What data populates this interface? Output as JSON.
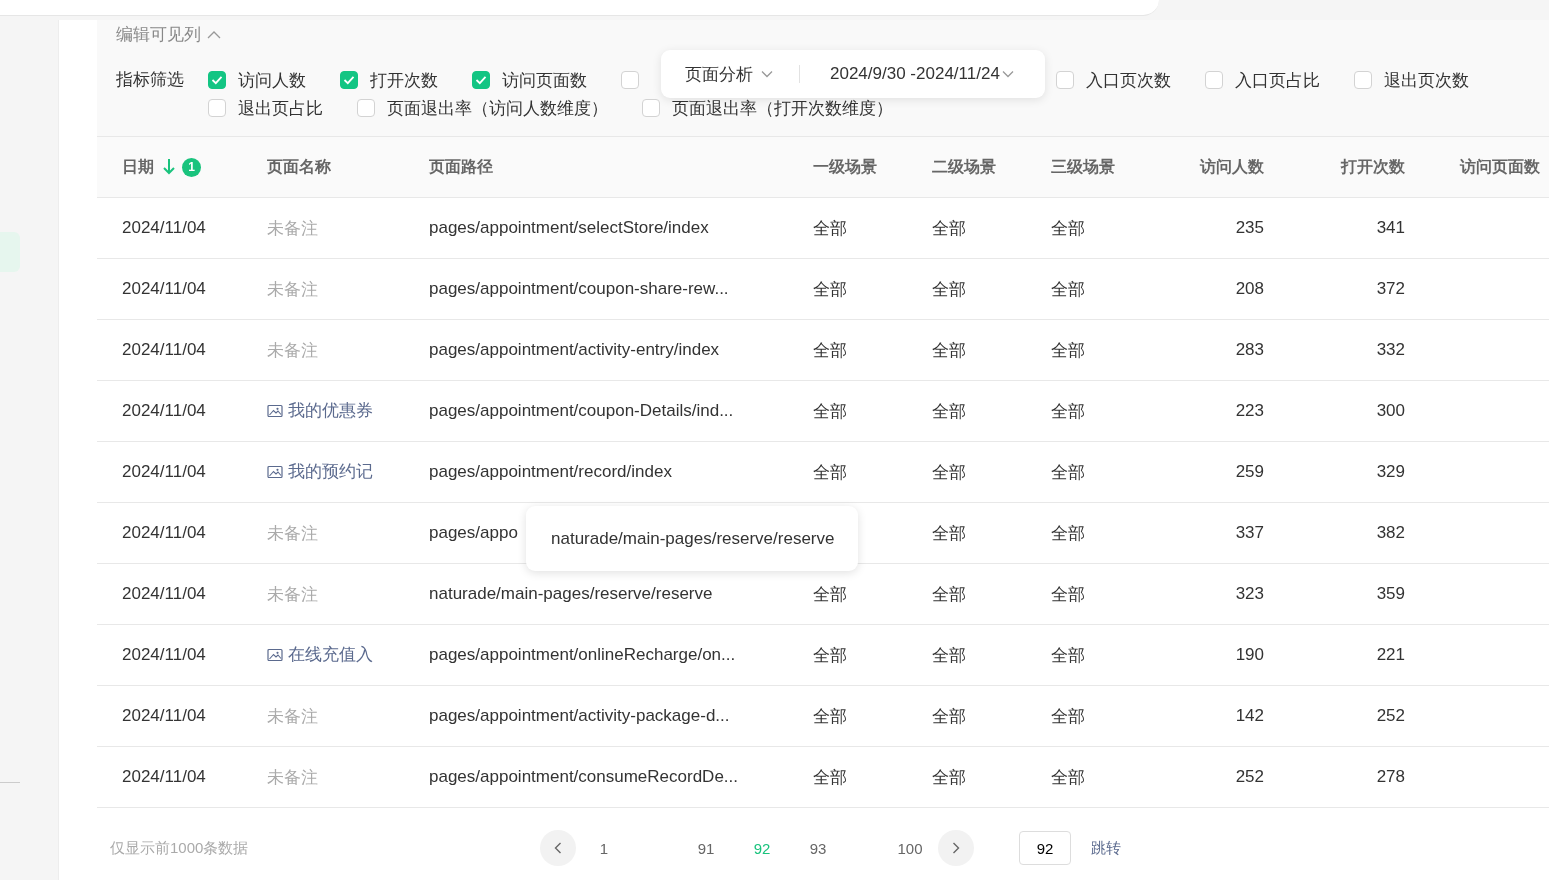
{
  "column_editor": {
    "label": "编辑可见列",
    "expanded": true
  },
  "metric_filter": {
    "label": "指标筛选",
    "items": [
      {
        "label": "访问人数",
        "checked": true
      },
      {
        "label": "打开次数",
        "checked": true
      },
      {
        "label": "访问页面数",
        "checked": true
      },
      {
        "checked": false
      },
      {
        "label": "入口页次数",
        "checked": false
      },
      {
        "label": "入口页占比",
        "checked": false
      },
      {
        "label": "退出页次数",
        "checked": false
      },
      {
        "label": "退出页占比",
        "checked": false
      },
      {
        "label": "页面退出率（访问人数维度）",
        "checked": false
      },
      {
        "label": "页面退出率（打开次数维度）",
        "checked": false
      }
    ]
  },
  "popover": {
    "analysis_select": "页面分析",
    "date_range": "2024/9/30 -2024/11/24"
  },
  "table": {
    "columns": [
      {
        "label": "日期",
        "sorted_descending": true,
        "sort_badge": "1"
      },
      {
        "label": "页面名称"
      },
      {
        "label": "页面路径"
      },
      {
        "label": "一级场景"
      },
      {
        "label": "二级场景"
      },
      {
        "label": "三级场景"
      },
      {
        "label": "访问人数"
      },
      {
        "label": "打开次数"
      },
      {
        "label": "访问页面数"
      }
    ],
    "rows": [
      {
        "date": "2024/11/04",
        "name": {
          "kind": "note",
          "text": "未备注"
        },
        "path": "pages/appointment/selectStore/index",
        "scene1": "全部",
        "scene2": "全部",
        "scene3": "全部",
        "visitors": "235",
        "opens": "341"
      },
      {
        "date": "2024/11/04",
        "name": {
          "kind": "note",
          "text": "未备注"
        },
        "path": "pages/appointment/coupon-share-rew...",
        "scene1": "全部",
        "scene2": "全部",
        "scene3": "全部",
        "visitors": "208",
        "opens": "372"
      },
      {
        "date": "2024/11/04",
        "name": {
          "kind": "note",
          "text": "未备注"
        },
        "path": "pages/appointment/activity-entry/index",
        "scene1": "全部",
        "scene2": "全部",
        "scene3": "全部",
        "visitors": "283",
        "opens": "332"
      },
      {
        "date": "2024/11/04",
        "name": {
          "kind": "custom",
          "text": "我的优惠券"
        },
        "path": "pages/appointment/coupon-Details/ind...",
        "scene1": "全部",
        "scene2": "全部",
        "scene3": "全部",
        "visitors": "223",
        "opens": "300"
      },
      {
        "date": "2024/11/04",
        "name": {
          "kind": "custom",
          "text": "我的预约记"
        },
        "path": "pages/appointment/record/index",
        "scene1": "全部",
        "scene2": "全部",
        "scene3": "全部",
        "visitors": "259",
        "opens": "329"
      },
      {
        "date": "2024/11/04",
        "name": {
          "kind": "note",
          "text": "未备注"
        },
        "path": "pages/appo",
        "scene2": "全部",
        "scene3": "全部",
        "visitors": "337",
        "opens": "382",
        "tooltip": "naturade/main-pages/reserve/reserve"
      },
      {
        "date": "2024/11/04",
        "name": {
          "kind": "note",
          "text": "未备注"
        },
        "path": "naturade/main-pages/reserve/reserve",
        "scene1": "全部",
        "scene2": "全部",
        "scene3": "全部",
        "visitors": "323",
        "opens": "359"
      },
      {
        "date": "2024/11/04",
        "name": {
          "kind": "custom",
          "text": "在线充值入"
        },
        "path": "pages/appointment/onlineRecharge/on...",
        "scene1": "全部",
        "scene2": "全部",
        "scene3": "全部",
        "visitors": "190",
        "opens": "221"
      },
      {
        "date": "2024/11/04",
        "name": {
          "kind": "note",
          "text": "未备注"
        },
        "path": "pages/appointment/activity-package-d...",
        "scene1": "全部",
        "scene2": "全部",
        "scene3": "全部",
        "visitors": "142",
        "opens": "252"
      },
      {
        "date": "2024/11/04",
        "name": {
          "kind": "note",
          "text": "未备注"
        },
        "path": "pages/appointment/consumeRecordDe...",
        "scene1": "全部",
        "scene2": "全部",
        "scene3": "全部",
        "visitors": "252",
        "opens": "278"
      }
    ]
  },
  "pagination": {
    "note": "仅显示前1000条数据",
    "pages": [
      {
        "label": "1",
        "selected": false
      },
      {
        "label": "91",
        "selected": false
      },
      {
        "label": "92",
        "selected": true
      },
      {
        "label": "93",
        "selected": false
      },
      {
        "label": "100",
        "selected": false
      }
    ],
    "jump_value": "92",
    "jump_label": "跳转"
  }
}
